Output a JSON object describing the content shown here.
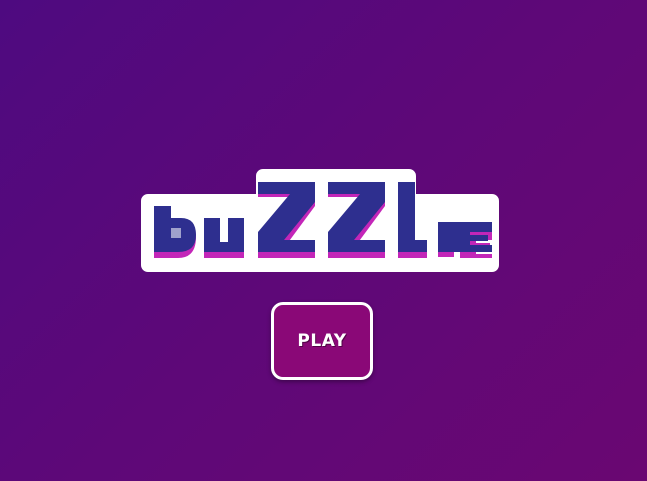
{
  "game": {
    "title": "buZZle",
    "play_label": "PLAY"
  },
  "colors": {
    "background_start": "#4e0a80",
    "background_end": "#6a0772",
    "logo_fill": "#2e2f8f",
    "logo_shadow": "#c326b8",
    "logo_outline": "#ffffff",
    "button_fill": "#8a0877",
    "button_border": "#ffffff"
  }
}
